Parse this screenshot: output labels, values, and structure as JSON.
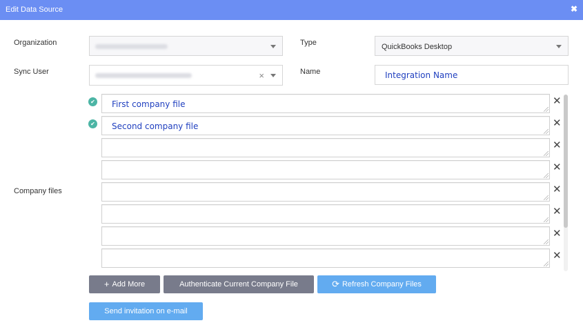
{
  "dialog": {
    "title": "Edit Data Source",
    "close_icon": "close-icon"
  },
  "form": {
    "organization_label": "Organization",
    "sync_user_label": "Sync User",
    "type_label": "Type",
    "type_value": "QuickBooks Desktop",
    "name_label": "Name",
    "name_value": "Integration Name",
    "company_files_label": "Company files"
  },
  "company_files": [
    {
      "value": "First company file",
      "verified": true
    },
    {
      "value": "Second company file",
      "verified": true
    },
    {
      "value": "",
      "verified": false
    },
    {
      "value": "",
      "verified": false
    },
    {
      "value": "",
      "verified": false
    },
    {
      "value": "",
      "verified": false
    },
    {
      "value": "",
      "verified": false
    },
    {
      "value": "",
      "verified": false
    }
  ],
  "buttons": {
    "add_more": "Add More",
    "authenticate": "Authenticate Current Company File",
    "refresh": "Refresh Company Files",
    "send_invitation": "Send invitation on e-mail"
  },
  "colors": {
    "header": "#6b8ef3",
    "check": "#4cb5a5",
    "button_gray": "#787b8b",
    "button_blue": "#62abf0",
    "input_text": "#1f3fbf"
  }
}
